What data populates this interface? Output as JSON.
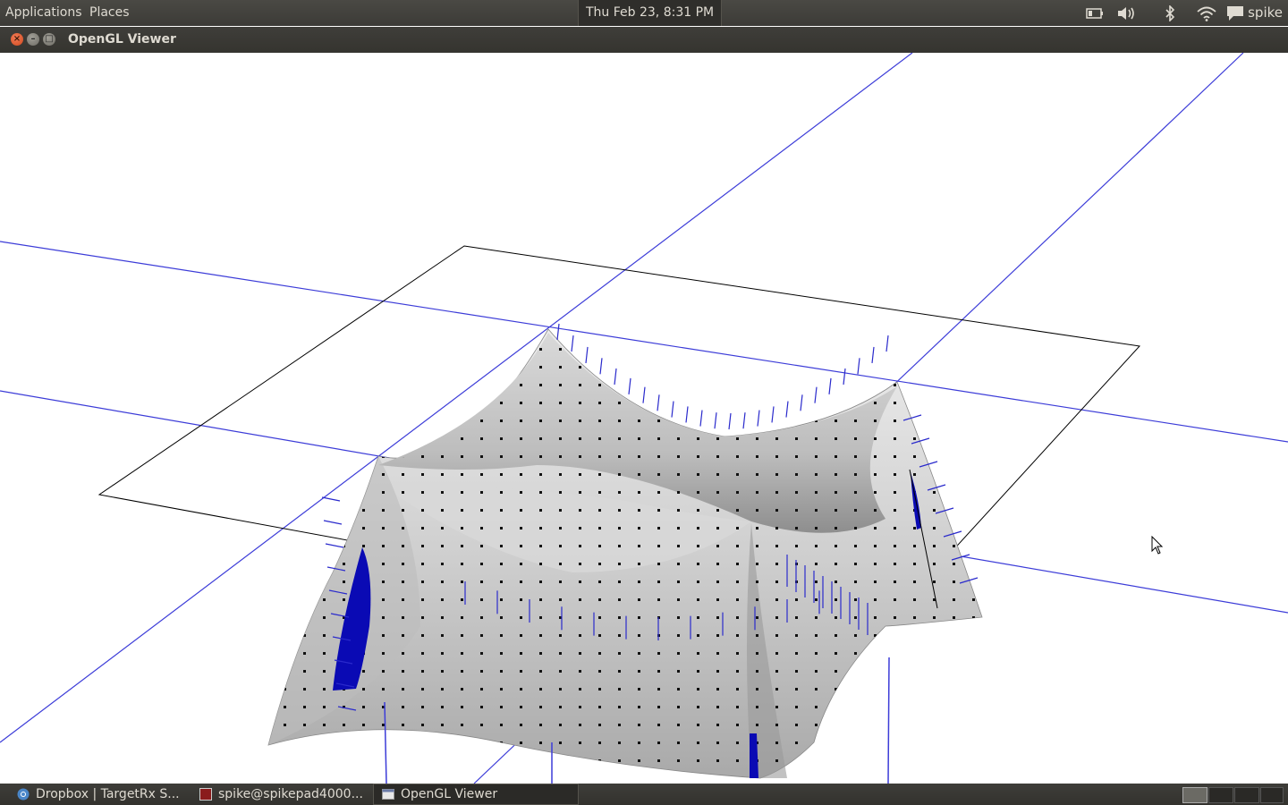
{
  "top_panel": {
    "menus": [
      {
        "label": "Applications"
      },
      {
        "label": "Places"
      }
    ],
    "clock": "Thu Feb 23,  8:31 PM",
    "tray_icons": [
      "battery-icon",
      "volume-icon",
      "bluetooth-icon",
      "wifi-icon",
      "chat-icon"
    ],
    "user": "spike"
  },
  "window": {
    "title": "OpenGL Viewer",
    "buttons": [
      "close",
      "minimize",
      "maximize"
    ]
  },
  "scene": {
    "description_colors": {
      "background": "#ffffff",
      "grid_lines": "#3c3cd8",
      "bounding_box": "#000000",
      "surface": "#cfcfcf",
      "normals": "#2a2acc",
      "highlight_patch": "#0a0ab4"
    }
  },
  "taskbar": {
    "tasks": [
      {
        "label": "Dropbox | TargetRx S...",
        "icon": "chrome-icon",
        "active": false
      },
      {
        "label": "spike@spikepad4000...",
        "icon": "terminal-icon",
        "active": false
      },
      {
        "label": "OpenGL Viewer",
        "icon": "window-icon",
        "active": true
      }
    ],
    "workspaces": 4,
    "active_workspace": 1
  }
}
